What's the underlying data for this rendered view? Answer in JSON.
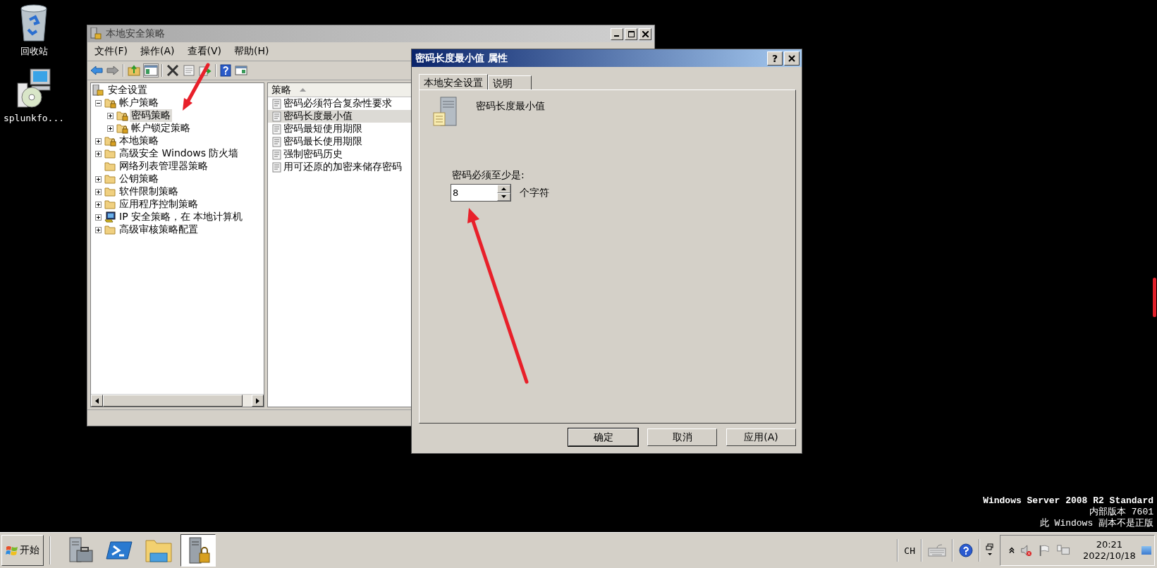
{
  "desktop": {
    "icons": [
      {
        "label": "回收站",
        "kind": "recycle-bin"
      },
      {
        "label": "splunkfo...",
        "kind": "installer"
      }
    ],
    "edition": [
      "Windows Server 2008 R2 Standard",
      "内部版本 7601",
      "此 Windows 副本不是正版"
    ]
  },
  "main_window": {
    "title": "本地安全策略",
    "menu": [
      "文件(F)",
      "操作(A)",
      "查看(V)",
      "帮助(H)"
    ],
    "tree": {
      "root": "安全设置",
      "items": [
        {
          "label": "帐户策略",
          "kind": "lock-folder",
          "expandable": true,
          "expanded": true,
          "selected": false,
          "children": [
            {
              "label": "密码策略",
              "kind": "lock-folder",
              "expandable": true,
              "expanded": false,
              "selected": true
            },
            {
              "label": "帐户锁定策略",
              "kind": "lock-folder",
              "expandable": true,
              "expanded": false,
              "selected": false
            }
          ]
        },
        {
          "label": "本地策略",
          "kind": "lock-folder",
          "expandable": true,
          "expanded": false,
          "selected": false
        },
        {
          "label": "高级安全 Windows 防火墙",
          "kind": "folder",
          "expandable": true,
          "expanded": false,
          "selected": false
        },
        {
          "label": "网络列表管理器策略",
          "kind": "folder",
          "expandable": false,
          "selected": false
        },
        {
          "label": "公钥策略",
          "kind": "folder",
          "expandable": true,
          "expanded": false,
          "selected": false
        },
        {
          "label": "软件限制策略",
          "kind": "folder",
          "expandable": true,
          "expanded": false,
          "selected": false
        },
        {
          "label": "应用程序控制策略",
          "kind": "folder",
          "expandable": true,
          "expanded": false,
          "selected": false
        },
        {
          "label": "IP 安全策略，在 本地计算机",
          "kind": "ip-security",
          "expandable": true,
          "expanded": false,
          "selected": false
        },
        {
          "label": "高级审核策略配置",
          "kind": "folder",
          "expandable": true,
          "expanded": false,
          "selected": false
        }
      ]
    },
    "list": {
      "column": "策略",
      "items": [
        {
          "label": "密码必须符合复杂性要求",
          "selected": false
        },
        {
          "label": "密码长度最小值",
          "selected": true
        },
        {
          "label": "密码最短使用期限",
          "selected": false
        },
        {
          "label": "密码最长使用期限",
          "selected": false
        },
        {
          "label": "强制密码历史",
          "selected": false
        },
        {
          "label": "用可还原的加密来储存密码",
          "selected": false
        }
      ]
    }
  },
  "dialog": {
    "title": "密码长度最小值 属性",
    "help": "?",
    "tabs": [
      {
        "label": "本地安全设置",
        "selected": true
      },
      {
        "label": "说明",
        "selected": false
      }
    ],
    "heading": "密码长度最小值",
    "field_label": "密码必须至少是:",
    "value": "8",
    "unit": "个字符",
    "buttons": [
      {
        "label": "确定",
        "default": true
      },
      {
        "label": "取消",
        "default": false
      },
      {
        "label": "应用(A)",
        "default": false
      }
    ]
  },
  "taskbar": {
    "start": "开始",
    "apps": [
      {
        "kind": "server-manager",
        "active": false
      },
      {
        "kind": "powershell",
        "active": false
      },
      {
        "kind": "explorer",
        "active": false
      },
      {
        "kind": "security-policy",
        "active": true
      }
    ],
    "language": "CH",
    "clock": {
      "time": "20:21",
      "date": "2022/10/18"
    }
  }
}
